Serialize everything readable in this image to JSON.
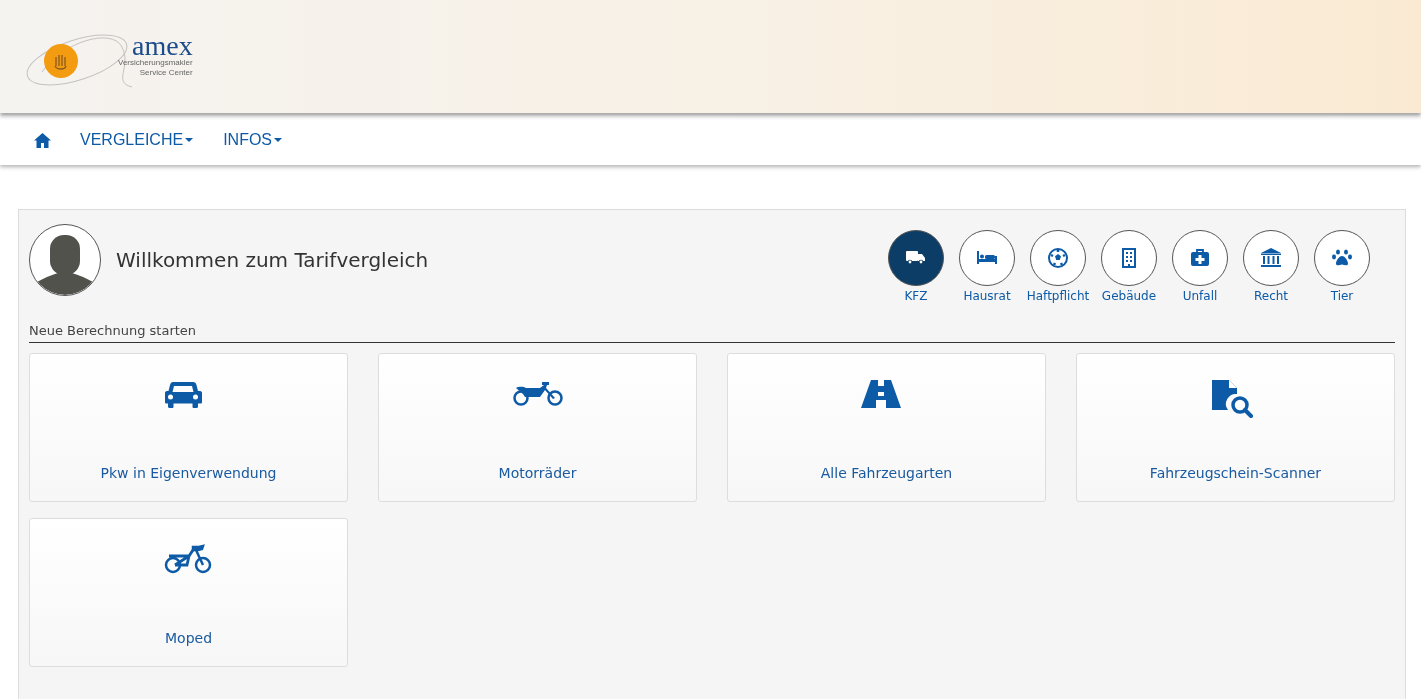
{
  "logo": {
    "name": "amex",
    "line_1": "Versicherungsmakler",
    "line_2": "Service Center"
  },
  "nav": [
    {
      "kind": "home"
    },
    {
      "kind": "menu",
      "label": "VERGLEICHE"
    },
    {
      "kind": "menu",
      "label": "INFOS"
    }
  ],
  "welcome": {
    "title": "Willkommen zum Tarifvergleich"
  },
  "categories": [
    {
      "label": "KFZ",
      "selected": true
    },
    {
      "label": "Hausrat",
      "selected": false
    },
    {
      "label": "Haftpflicht",
      "selected": false
    },
    {
      "label": "Gebäude",
      "selected": false
    },
    {
      "label": "Unfall",
      "selected": false
    },
    {
      "label": "Recht",
      "selected": false
    },
    {
      "label": "Tier",
      "selected": false
    }
  ],
  "section_title": "Neue Berechnung starten",
  "tiles": [
    {
      "label": "Pkw in Eigenverwendung"
    },
    {
      "label": "Motorräder"
    },
    {
      "label": "Alle Fahrzeugarten"
    },
    {
      "label": "Fahrzeugschein-Scanner"
    },
    {
      "label": "Moped"
    }
  ]
}
